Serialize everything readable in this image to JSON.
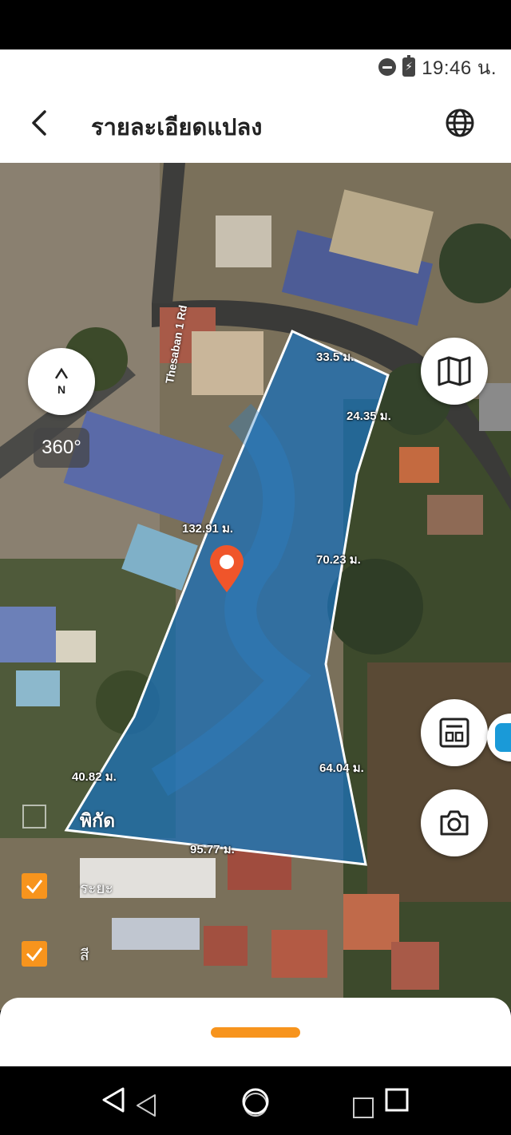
{
  "status_bar": {
    "time": "19:46 น.",
    "dnd_icon": "do-not-disturb-icon",
    "battery_icon": "battery-charging-icon"
  },
  "header": {
    "title": "รายละเอียดแปลง",
    "back_icon": "back-arrow-icon",
    "globe_icon": "globe-icon"
  },
  "map": {
    "road_label": "Thesaban 1 Rd",
    "compass_label": "N",
    "btn_360_label": "360°",
    "coordinates_label": "พิกัด",
    "measurements": {
      "top": "33.5 ม.",
      "top_right": "24.35 ม.",
      "left_upper": "132.91 ม.",
      "right_upper": "70.23 ม.",
      "left_lower": "40.82 ม.",
      "right_lower": "64.04 ม.",
      "bottom": "95.77 ม."
    },
    "pin_icon": "location-pin-icon",
    "buttons": {
      "map_layers_icon": "map-icon",
      "scan_icon": "land-document-icon",
      "camera_icon": "camera-icon",
      "cube_icon": "cube-icon"
    },
    "layers": [
      {
        "label": "ระยะ",
        "checked": true
      },
      {
        "label": "สี",
        "checked": true
      }
    ]
  },
  "colors": {
    "accent": "#f7941d",
    "parcel_fill": "#1e6fb3",
    "pin": "#f0552a"
  },
  "nav": {
    "back_icon": "nav-back-icon",
    "home_icon": "nav-home-icon",
    "recents_icon": "nav-recents-icon"
  }
}
